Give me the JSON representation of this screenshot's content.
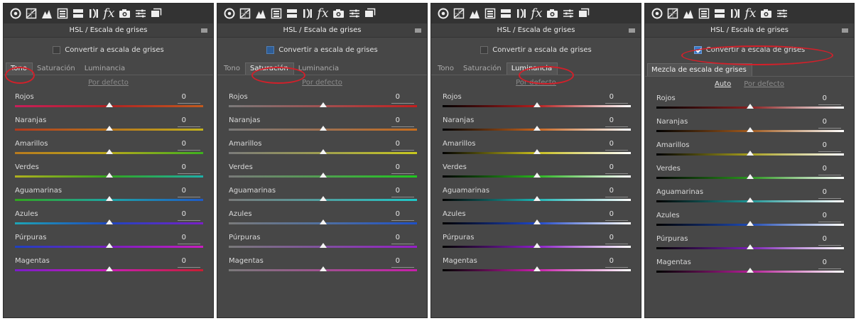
{
  "panels": [
    {
      "title": "HSL / Escala de grises",
      "grayscale": {
        "label": "Convertir a escala de grises",
        "checked": false
      },
      "tabs": [
        "Tono",
        "Saturación",
        "Luminancia"
      ],
      "active_tab": 0,
      "links": [
        "Por defecto"
      ],
      "sliders": [
        {
          "label": "Rojos",
          "value": "0",
          "level": 0,
          "gradient": [
            "#c81e5a",
            "#b02323",
            "#c25a1e"
          ]
        },
        {
          "label": "Naranjas",
          "value": "0",
          "level": 0,
          "gradient": [
            "#b23a1e",
            "#b8751c",
            "#c2b21e"
          ]
        },
        {
          "label": "Amarillos",
          "value": "0",
          "level": 0,
          "gradient": [
            "#b87a1e",
            "#b8a81c",
            "#3cb01e"
          ]
        },
        {
          "label": "Verdes",
          "value": "0",
          "level": 0,
          "gradient": [
            "#b0b01e",
            "#32a51e",
            "#1eb0a8"
          ]
        },
        {
          "label": "Aguamarinas",
          "value": "0",
          "level": 0,
          "gradient": [
            "#32a51e",
            "#1ea5a5",
            "#1e5ac8"
          ]
        },
        {
          "label": "Azules",
          "value": "0",
          "level": 0,
          "gradient": [
            "#1ea5b5",
            "#1e46c0",
            "#7a1ec8"
          ]
        },
        {
          "label": "Púrpuras",
          "value": "0",
          "level": 0,
          "gradient": [
            "#1e40c0",
            "#7a1ec0",
            "#c81ec0"
          ]
        },
        {
          "label": "Magentas",
          "value": "0",
          "level": 0,
          "gradient": [
            "#7a1ec8",
            "#c81eb4",
            "#c81e32"
          ]
        }
      ]
    },
    {
      "title": "HSL / Escala de grises",
      "grayscale": {
        "label": "Convertir a escala de grises",
        "checked": false
      },
      "tabs": [
        "Tono",
        "Saturación",
        "Luminancia"
      ],
      "active_tab": 1,
      "links": [
        "Por defecto"
      ],
      "sliders": [
        {
          "label": "Rojos",
          "value": "0",
          "level": 0,
          "gradient": [
            "#7a7a7a",
            "#a05050",
            "#c41e1e"
          ]
        },
        {
          "label": "Naranjas",
          "value": "0",
          "level": 0,
          "gradient": [
            "#7a7a7a",
            "#a07050",
            "#c86e1e"
          ]
        },
        {
          "label": "Amarillos",
          "value": "0",
          "level": 0,
          "gradient": [
            "#7a7a7a",
            "#a0a050",
            "#c8c81e"
          ]
        },
        {
          "label": "Verdes",
          "value": "0",
          "level": 0,
          "gradient": [
            "#7a7a7a",
            "#50a050",
            "#1ec81e"
          ]
        },
        {
          "label": "Aguamarinas",
          "value": "0",
          "level": 0,
          "gradient": [
            "#7a7a7a",
            "#50a0a0",
            "#1ec8c8"
          ]
        },
        {
          "label": "Azules",
          "value": "0",
          "level": 0,
          "gradient": [
            "#7a7a7a",
            "#5070a0",
            "#1e50c8"
          ]
        },
        {
          "label": "Púrpuras",
          "value": "0",
          "level": 0,
          "gradient": [
            "#7a7a7a",
            "#8050a0",
            "#961ec8"
          ]
        },
        {
          "label": "Magentas",
          "value": "0",
          "level": 0,
          "gradient": [
            "#7a7a7a",
            "#a05090",
            "#c81eaa"
          ]
        }
      ]
    },
    {
      "title": "HSL / Escala de grises",
      "grayscale": {
        "label": "Convertir a escala de grises",
        "checked": false
      },
      "tabs": [
        "Tono",
        "Saturación",
        "Luminancia"
      ],
      "active_tab": 2,
      "links": [
        "Por defecto"
      ],
      "sliders": [
        {
          "label": "Rojos",
          "value": "0",
          "level": 0,
          "gradient": [
            "#000000",
            "#b41e1e",
            "#ffffff"
          ]
        },
        {
          "label": "Naranjas",
          "value": "0",
          "level": 0,
          "gradient": [
            "#000000",
            "#c8641e",
            "#ffffff"
          ]
        },
        {
          "label": "Amarillos",
          "value": "0",
          "level": 0,
          "gradient": [
            "#000000",
            "#c8be1e",
            "#ffffff"
          ]
        },
        {
          "label": "Verdes",
          "value": "0",
          "level": 0,
          "gradient": [
            "#000000",
            "#28b41e",
            "#ffffff"
          ]
        },
        {
          "label": "Aguamarinas",
          "value": "0",
          "level": 0,
          "gradient": [
            "#000000",
            "#1eb4b4",
            "#ffffff"
          ]
        },
        {
          "label": "Azules",
          "value": "0",
          "level": 0,
          "gradient": [
            "#000000",
            "#1e46c8",
            "#ffffff"
          ]
        },
        {
          "label": "Púrpuras",
          "value": "0",
          "level": 0,
          "gradient": [
            "#000000",
            "#8c1ec8",
            "#ffffff"
          ]
        },
        {
          "label": "Magentas",
          "value": "0",
          "level": 0,
          "gradient": [
            "#000000",
            "#c81eaa",
            "#ffffff"
          ]
        }
      ]
    },
    {
      "title": "HSL / Escala de grises",
      "grayscale": {
        "label": "Convertir a escala de grises",
        "checked": true
      },
      "mix_tab": "Mezcla de escala de grises",
      "links": [
        "Auto",
        "Por defecto"
      ],
      "sliders": [
        {
          "label": "Rojos",
          "value": "0",
          "level": 0,
          "gradient": [
            "#000000",
            "#8a1e1e",
            "#ffffff"
          ]
        },
        {
          "label": "Naranjas",
          "value": "0",
          "level": 0,
          "gradient": [
            "#000000",
            "#a05a1e",
            "#ffffff"
          ]
        },
        {
          "label": "Amarillos",
          "value": "0",
          "level": 0,
          "gradient": [
            "#000000",
            "#a8a01e",
            "#ffffff"
          ]
        },
        {
          "label": "Verdes",
          "value": "0",
          "level": 0,
          "gradient": [
            "#000000",
            "#2a961e",
            "#ffffff"
          ]
        },
        {
          "label": "Aguamarinas",
          "value": "0",
          "level": 0,
          "gradient": [
            "#000000",
            "#1e9696",
            "#ffffff"
          ]
        },
        {
          "label": "Azules",
          "value": "0",
          "level": 0,
          "gradient": [
            "#000000",
            "#1e4ab4",
            "#ffffff"
          ]
        },
        {
          "label": "Púrpuras",
          "value": "0",
          "level": 0,
          "gradient": [
            "#000000",
            "#7a1eb4",
            "#ffffff"
          ]
        },
        {
          "label": "Magentas",
          "value": "0",
          "level": 0,
          "gradient": [
            "#000000",
            "#b41e96",
            "#ffffff"
          ]
        }
      ]
    }
  ],
  "toolbar_icons": [
    "basic-panel-icon",
    "tone-curve-icon",
    "detail-icon",
    "hsl-icon",
    "split-toning-icon",
    "lens-corrections-icon",
    "effects-icon",
    "camera-calibration-icon",
    "presets-icon",
    "snapshots-icon"
  ],
  "colors": {
    "panel": "#474747",
    "toolbar": "#333333",
    "highlight": "#d2202a",
    "checkbox_checked": "#3b79c4"
  }
}
